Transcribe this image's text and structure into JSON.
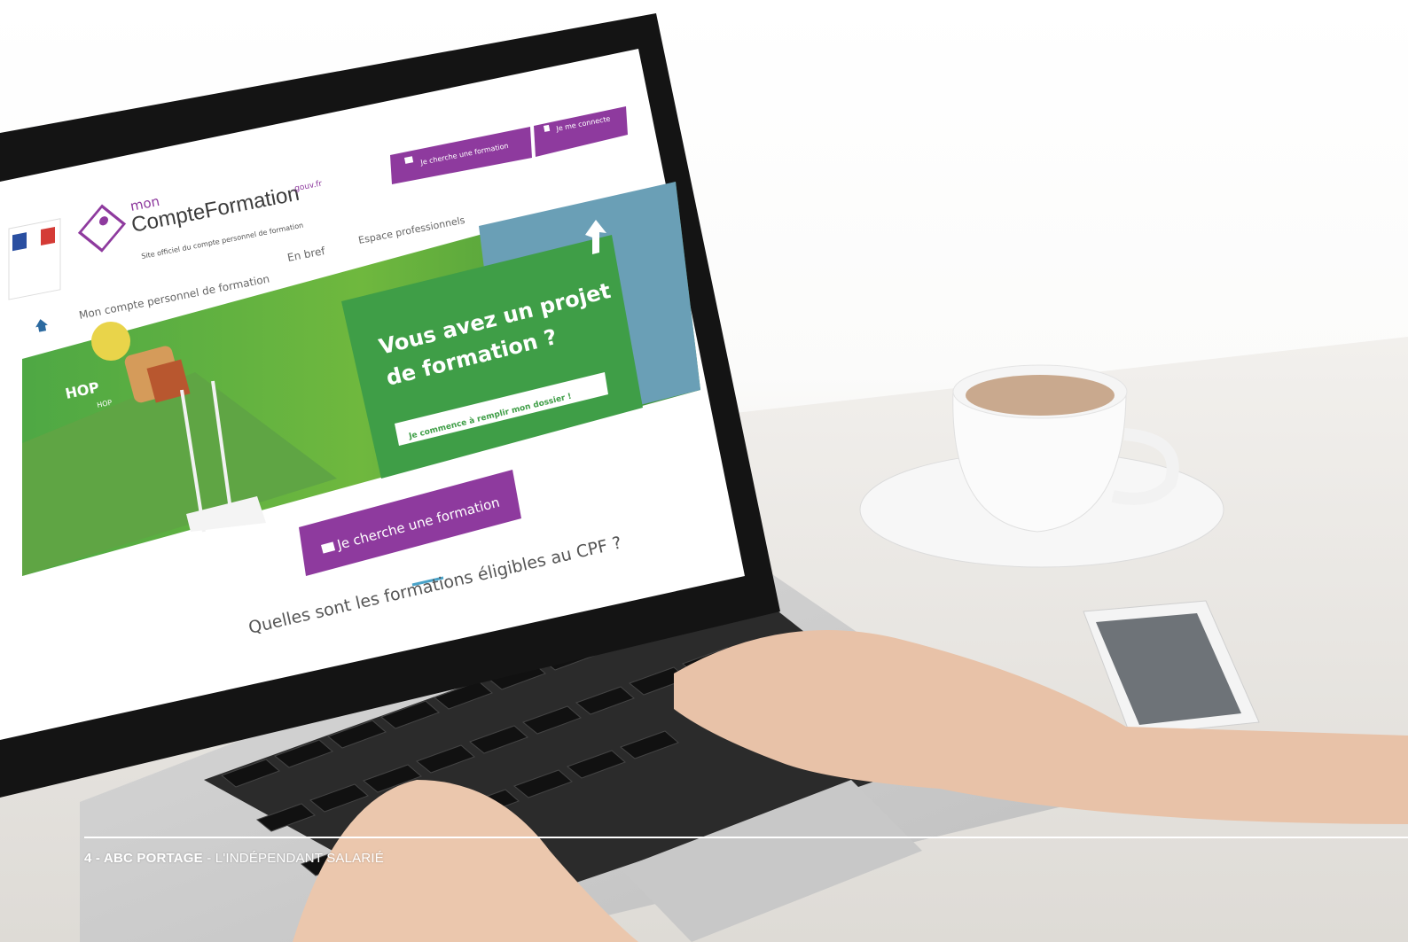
{
  "site": {
    "logo_mon": "mon",
    "logo_main": "CompteFormation",
    "logo_domain": ".gouv.fr",
    "tagline": "Site officiel du compte personnel de formation",
    "top_buttons": [
      {
        "label": "Je cherche une formation",
        "icon": "folder-icon"
      },
      {
        "label": "Je me connecte",
        "icon": "lock-icon"
      }
    ],
    "nav": [
      {
        "label": "Mon compte personnel de formation"
      },
      {
        "label": "En bref"
      },
      {
        "label": "Espace professionnels"
      }
    ],
    "hero_title_line1": "Vous avez un projet",
    "hero_title_line2": "de formation ?",
    "hero_cta": "Je commence à remplir mon dossier !",
    "hop_big": "HOP",
    "hop_small": "HOP",
    "main_cta": "Je cherche une formation",
    "section_title": "Quelles sont les formations éligibles au CPF ?"
  },
  "footer": {
    "page": "4 - ",
    "brand": "ABC PORTAGE",
    "subtitle": " - L'INDÉPENDANT SALARIÉ"
  },
  "colors": {
    "purple": "#8e3a9e",
    "green": "#3f9e47",
    "dark_green": "#2f7f3a",
    "bezel": "#1a1a1a"
  }
}
